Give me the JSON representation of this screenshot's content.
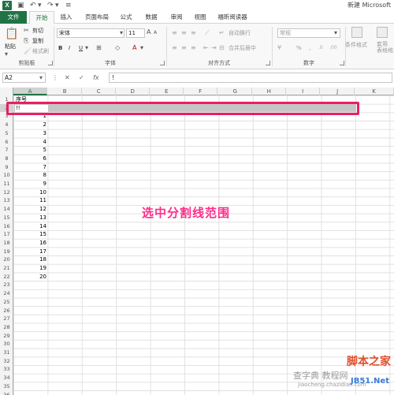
{
  "titlebar": {
    "app_icon": "X",
    "doc_title": "新建 Microsoft",
    "qat_icons": [
      "save-icon",
      "undo-icon",
      "redo-icon",
      "customize-qat-icon"
    ]
  },
  "tabs": [
    {
      "label": "文件"
    },
    {
      "label": "开始"
    },
    {
      "label": "插入"
    },
    {
      "label": "页面布局"
    },
    {
      "label": "公式"
    },
    {
      "label": "数据"
    },
    {
      "label": "审阅"
    },
    {
      "label": "视图"
    },
    {
      "label": "福昕阅读器"
    }
  ],
  "ribbon": {
    "clipboard": {
      "paste": "粘贴",
      "cut": "剪切",
      "copy": "复制",
      "format_painter": "格式刷",
      "group": "剪贴板"
    },
    "font": {
      "name": "宋体",
      "size": "11",
      "bold": "B",
      "italic": "I",
      "underline": "U",
      "group": "字体"
    },
    "alignment": {
      "wrap": "自动换行",
      "merge": "合并后居中",
      "group": "对齐方式"
    },
    "number": {
      "format": "常规",
      "percent": "%",
      "comma": ",",
      "group": "数字"
    },
    "styles": {
      "conditional": "条件格式",
      "table": "套用\n表格格式"
    }
  },
  "formula_bar": {
    "name_box": "A2",
    "cancel": "✕",
    "enter": "✓",
    "fx": "fx",
    "content": "!"
  },
  "columns": [
    "A",
    "B",
    "C",
    "D",
    "E",
    "F",
    "G",
    "H",
    "I",
    "J",
    "K"
  ],
  "rows": [
    "1",
    "2",
    "3",
    "4",
    "5",
    "6",
    "7",
    "8",
    "9",
    "10",
    "11",
    "12",
    "13",
    "14",
    "15",
    "16",
    "17",
    "18",
    "19",
    "20",
    "21",
    "22",
    "23",
    "24",
    "25",
    "26",
    "27",
    "28",
    "29",
    "30",
    "31",
    "32",
    "33",
    "34",
    "35",
    "36"
  ],
  "cells": {
    "A1": "序号",
    "A2": "!!",
    "numbers": [
      "1",
      "2",
      "3",
      "4",
      "5",
      "6",
      "7",
      "8",
      "9",
      "10",
      "11",
      "12",
      "13",
      "14",
      "15",
      "16",
      "17",
      "18",
      "19",
      "20"
    ]
  },
  "annotation": "选中分割线范围",
  "colors": {
    "accent": "#217346",
    "highlight": "#e8205f",
    "annotation": "#ff2d8a"
  }
}
